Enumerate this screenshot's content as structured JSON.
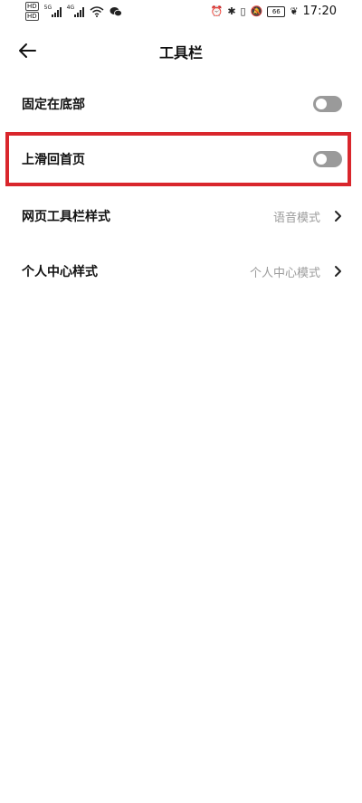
{
  "status_bar": {
    "hd1": "HD",
    "hd2": "HD",
    "network1": "5G",
    "network2": "4G",
    "battery": "66",
    "time": "17:20"
  },
  "header": {
    "title": "工具栏"
  },
  "settings": [
    {
      "label": "固定在底部",
      "control": "toggle",
      "enabled": false
    },
    {
      "label": "上滑回首页",
      "control": "toggle",
      "enabled": false
    },
    {
      "label": "网页工具栏样式",
      "control": "link",
      "value": "语音模式"
    },
    {
      "label": "个人中心样式",
      "control": "link",
      "value": "个人中心模式"
    }
  ],
  "highlight_color": "#d9262c",
  "toggle_off_color": "#9a9a9a"
}
